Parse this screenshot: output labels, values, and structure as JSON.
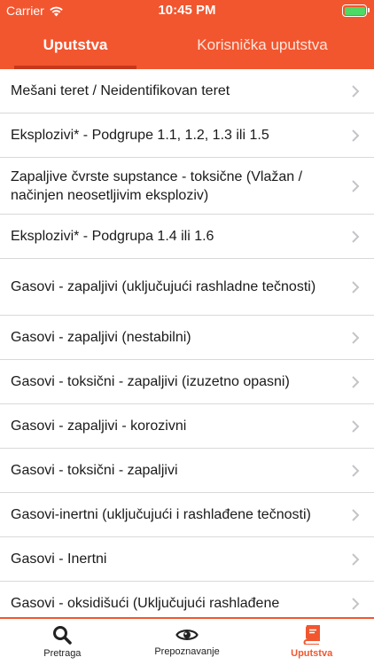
{
  "status": {
    "carrier": "Carrier",
    "time": "10:45 PM"
  },
  "tabs": [
    {
      "label": "Uputstva"
    },
    {
      "label": "Korisnička uputstva"
    }
  ],
  "list": [
    {
      "label": "Mešani teret / Neidentifikovan teret"
    },
    {
      "label": "Eksplozivi* - Podgrupe 1.1, 1.2, 1.3 ili 1.5"
    },
    {
      "label": "Zapaljive čvrste supstance - toksične (Vlažan / načinjen neosetljivim eksploziv)"
    },
    {
      "label": "Eksplozivi* - Podgrupa 1.4 ili 1.6"
    },
    {
      "label": "Gasovi - zapaljivi (uključujući rashladne tečnosti)"
    },
    {
      "label": "Gasovi - zapaljivi (nestabilni)"
    },
    {
      "label": "Gasovi - toksični - zapaljivi (izuzetno opasni)"
    },
    {
      "label": "Gasovi - zapaljivi - korozivni"
    },
    {
      "label": "Gasovi - toksični - zapaljivi"
    },
    {
      "label": "Gasovi-inertni (uključujući i rashlađene tečnosti)"
    },
    {
      "label": "Gasovi - Inertni"
    },
    {
      "label": "Gasovi - oksidišući (Uključujući rashlađene"
    }
  ],
  "tabbar": [
    {
      "label": "Pretraga",
      "icon": "search-icon"
    },
    {
      "label": "Prepoznavanje",
      "icon": "eye-icon"
    },
    {
      "label": "Uputstva",
      "icon": "book-icon"
    }
  ],
  "colors": {
    "accent": "#f2562f",
    "indicator": "#c6381a",
    "battery": "#4cd964"
  }
}
